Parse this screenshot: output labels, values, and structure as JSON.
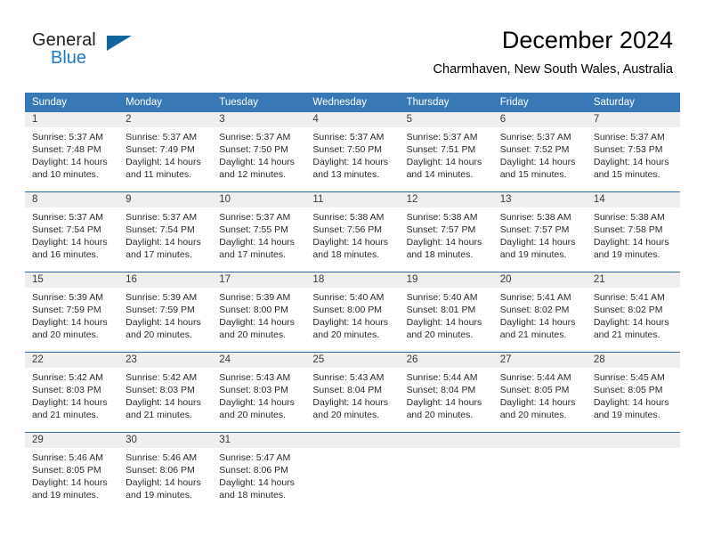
{
  "brand": {
    "name_top": "General",
    "name_bottom": "Blue",
    "flag_icon": "triangle-flag-icon",
    "accent_color": "#1f7ac4",
    "flag_color": "#11659f"
  },
  "header": {
    "month_title": "December 2024",
    "location": "Charmhaven, New South Wales, Australia"
  },
  "calendar": {
    "header_color": "#3878b4",
    "daynum_band_color": "#efefef",
    "weekdays": [
      "Sunday",
      "Monday",
      "Tuesday",
      "Wednesday",
      "Thursday",
      "Friday",
      "Saturday"
    ],
    "weeks": [
      [
        {
          "day": "1",
          "sunrise": "Sunrise: 5:37 AM",
          "sunset": "Sunset: 7:48 PM",
          "daylight_1": "Daylight: 14 hours",
          "daylight_2": "and 10 minutes."
        },
        {
          "day": "2",
          "sunrise": "Sunrise: 5:37 AM",
          "sunset": "Sunset: 7:49 PM",
          "daylight_1": "Daylight: 14 hours",
          "daylight_2": "and 11 minutes."
        },
        {
          "day": "3",
          "sunrise": "Sunrise: 5:37 AM",
          "sunset": "Sunset: 7:50 PM",
          "daylight_1": "Daylight: 14 hours",
          "daylight_2": "and 12 minutes."
        },
        {
          "day": "4",
          "sunrise": "Sunrise: 5:37 AM",
          "sunset": "Sunset: 7:50 PM",
          "daylight_1": "Daylight: 14 hours",
          "daylight_2": "and 13 minutes."
        },
        {
          "day": "5",
          "sunrise": "Sunrise: 5:37 AM",
          "sunset": "Sunset: 7:51 PM",
          "daylight_1": "Daylight: 14 hours",
          "daylight_2": "and 14 minutes."
        },
        {
          "day": "6",
          "sunrise": "Sunrise: 5:37 AM",
          "sunset": "Sunset: 7:52 PM",
          "daylight_1": "Daylight: 14 hours",
          "daylight_2": "and 15 minutes."
        },
        {
          "day": "7",
          "sunrise": "Sunrise: 5:37 AM",
          "sunset": "Sunset: 7:53 PM",
          "daylight_1": "Daylight: 14 hours",
          "daylight_2": "and 15 minutes."
        }
      ],
      [
        {
          "day": "8",
          "sunrise": "Sunrise: 5:37 AM",
          "sunset": "Sunset: 7:54 PM",
          "daylight_1": "Daylight: 14 hours",
          "daylight_2": "and 16 minutes."
        },
        {
          "day": "9",
          "sunrise": "Sunrise: 5:37 AM",
          "sunset": "Sunset: 7:54 PM",
          "daylight_1": "Daylight: 14 hours",
          "daylight_2": "and 17 minutes."
        },
        {
          "day": "10",
          "sunrise": "Sunrise: 5:37 AM",
          "sunset": "Sunset: 7:55 PM",
          "daylight_1": "Daylight: 14 hours",
          "daylight_2": "and 17 minutes."
        },
        {
          "day": "11",
          "sunrise": "Sunrise: 5:38 AM",
          "sunset": "Sunset: 7:56 PM",
          "daylight_1": "Daylight: 14 hours",
          "daylight_2": "and 18 minutes."
        },
        {
          "day": "12",
          "sunrise": "Sunrise: 5:38 AM",
          "sunset": "Sunset: 7:57 PM",
          "daylight_1": "Daylight: 14 hours",
          "daylight_2": "and 18 minutes."
        },
        {
          "day": "13",
          "sunrise": "Sunrise: 5:38 AM",
          "sunset": "Sunset: 7:57 PM",
          "daylight_1": "Daylight: 14 hours",
          "daylight_2": "and 19 minutes."
        },
        {
          "day": "14",
          "sunrise": "Sunrise: 5:38 AM",
          "sunset": "Sunset: 7:58 PM",
          "daylight_1": "Daylight: 14 hours",
          "daylight_2": "and 19 minutes."
        }
      ],
      [
        {
          "day": "15",
          "sunrise": "Sunrise: 5:39 AM",
          "sunset": "Sunset: 7:59 PM",
          "daylight_1": "Daylight: 14 hours",
          "daylight_2": "and 20 minutes."
        },
        {
          "day": "16",
          "sunrise": "Sunrise: 5:39 AM",
          "sunset": "Sunset: 7:59 PM",
          "daylight_1": "Daylight: 14 hours",
          "daylight_2": "and 20 minutes."
        },
        {
          "day": "17",
          "sunrise": "Sunrise: 5:39 AM",
          "sunset": "Sunset: 8:00 PM",
          "daylight_1": "Daylight: 14 hours",
          "daylight_2": "and 20 minutes."
        },
        {
          "day": "18",
          "sunrise": "Sunrise: 5:40 AM",
          "sunset": "Sunset: 8:00 PM",
          "daylight_1": "Daylight: 14 hours",
          "daylight_2": "and 20 minutes."
        },
        {
          "day": "19",
          "sunrise": "Sunrise: 5:40 AM",
          "sunset": "Sunset: 8:01 PM",
          "daylight_1": "Daylight: 14 hours",
          "daylight_2": "and 20 minutes."
        },
        {
          "day": "20",
          "sunrise": "Sunrise: 5:41 AM",
          "sunset": "Sunset: 8:02 PM",
          "daylight_1": "Daylight: 14 hours",
          "daylight_2": "and 21 minutes."
        },
        {
          "day": "21",
          "sunrise": "Sunrise: 5:41 AM",
          "sunset": "Sunset: 8:02 PM",
          "daylight_1": "Daylight: 14 hours",
          "daylight_2": "and 21 minutes."
        }
      ],
      [
        {
          "day": "22",
          "sunrise": "Sunrise: 5:42 AM",
          "sunset": "Sunset: 8:03 PM",
          "daylight_1": "Daylight: 14 hours",
          "daylight_2": "and 21 minutes."
        },
        {
          "day": "23",
          "sunrise": "Sunrise: 5:42 AM",
          "sunset": "Sunset: 8:03 PM",
          "daylight_1": "Daylight: 14 hours",
          "daylight_2": "and 21 minutes."
        },
        {
          "day": "24",
          "sunrise": "Sunrise: 5:43 AM",
          "sunset": "Sunset: 8:03 PM",
          "daylight_1": "Daylight: 14 hours",
          "daylight_2": "and 20 minutes."
        },
        {
          "day": "25",
          "sunrise": "Sunrise: 5:43 AM",
          "sunset": "Sunset: 8:04 PM",
          "daylight_1": "Daylight: 14 hours",
          "daylight_2": "and 20 minutes."
        },
        {
          "day": "26",
          "sunrise": "Sunrise: 5:44 AM",
          "sunset": "Sunset: 8:04 PM",
          "daylight_1": "Daylight: 14 hours",
          "daylight_2": "and 20 minutes."
        },
        {
          "day": "27",
          "sunrise": "Sunrise: 5:44 AM",
          "sunset": "Sunset: 8:05 PM",
          "daylight_1": "Daylight: 14 hours",
          "daylight_2": "and 20 minutes."
        },
        {
          "day": "28",
          "sunrise": "Sunrise: 5:45 AM",
          "sunset": "Sunset: 8:05 PM",
          "daylight_1": "Daylight: 14 hours",
          "daylight_2": "and 19 minutes."
        }
      ],
      [
        {
          "day": "29",
          "sunrise": "Sunrise: 5:46 AM",
          "sunset": "Sunset: 8:05 PM",
          "daylight_1": "Daylight: 14 hours",
          "daylight_2": "and 19 minutes."
        },
        {
          "day": "30",
          "sunrise": "Sunrise: 5:46 AM",
          "sunset": "Sunset: 8:06 PM",
          "daylight_1": "Daylight: 14 hours",
          "daylight_2": "and 19 minutes."
        },
        {
          "day": "31",
          "sunrise": "Sunrise: 5:47 AM",
          "sunset": "Sunset: 8:06 PM",
          "daylight_1": "Daylight: 14 hours",
          "daylight_2": "and 18 minutes."
        },
        {
          "day": "",
          "sunrise": "",
          "sunset": "",
          "daylight_1": "",
          "daylight_2": ""
        },
        {
          "day": "",
          "sunrise": "",
          "sunset": "",
          "daylight_1": "",
          "daylight_2": ""
        },
        {
          "day": "",
          "sunrise": "",
          "sunset": "",
          "daylight_1": "",
          "daylight_2": ""
        },
        {
          "day": "",
          "sunrise": "",
          "sunset": "",
          "daylight_1": "",
          "daylight_2": ""
        }
      ]
    ]
  }
}
